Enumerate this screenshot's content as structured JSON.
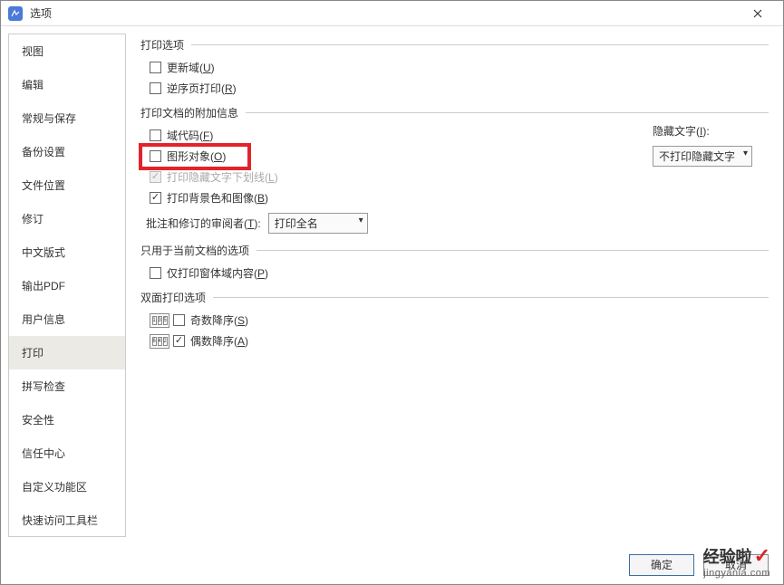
{
  "window": {
    "title": "选项"
  },
  "sidebar": {
    "items": [
      {
        "label": "视图"
      },
      {
        "label": "编辑"
      },
      {
        "label": "常规与保存"
      },
      {
        "label": "备份设置"
      },
      {
        "label": "文件位置"
      },
      {
        "label": "修订"
      },
      {
        "label": "中文版式"
      },
      {
        "label": "输出PDF"
      },
      {
        "label": "用户信息"
      },
      {
        "label": "打印"
      },
      {
        "label": "拼写检查"
      },
      {
        "label": "安全性"
      },
      {
        "label": "信任中心"
      },
      {
        "label": "自定义功能区"
      },
      {
        "label": "快速访问工具栏"
      }
    ],
    "active_index": 9
  },
  "groups": {
    "print_options": {
      "title": "打印选项",
      "update_fields": "更新域(U)",
      "reverse_print": "逆序页打印(R)"
    },
    "doc_info": {
      "title": "打印文档的附加信息",
      "field_codes": "域代码(F)",
      "graphic_objects": "图形对象(O)",
      "hidden_underline": "打印隐藏文字下划线(L)",
      "bg_images": "打印背景色和图像(B)",
      "reviewer_label": "批注和修订的审阅者(T):",
      "reviewer_value": "打印全名",
      "hidden_text_label": "隐藏文字(I):",
      "hidden_text_value": "不打印隐藏文字"
    },
    "current_doc": {
      "title": "只用于当前文档的选项",
      "form_fields": "仅打印窗体域内容(P)"
    },
    "duplex": {
      "title": "双面打印选项",
      "odd_desc": "奇数降序(S)",
      "even_desc": "偶数降序(A)"
    }
  },
  "footer": {
    "ok": "确定",
    "cancel": "取消"
  },
  "watermark": {
    "line1": "经验啦",
    "line2": "jingyanla.com"
  }
}
